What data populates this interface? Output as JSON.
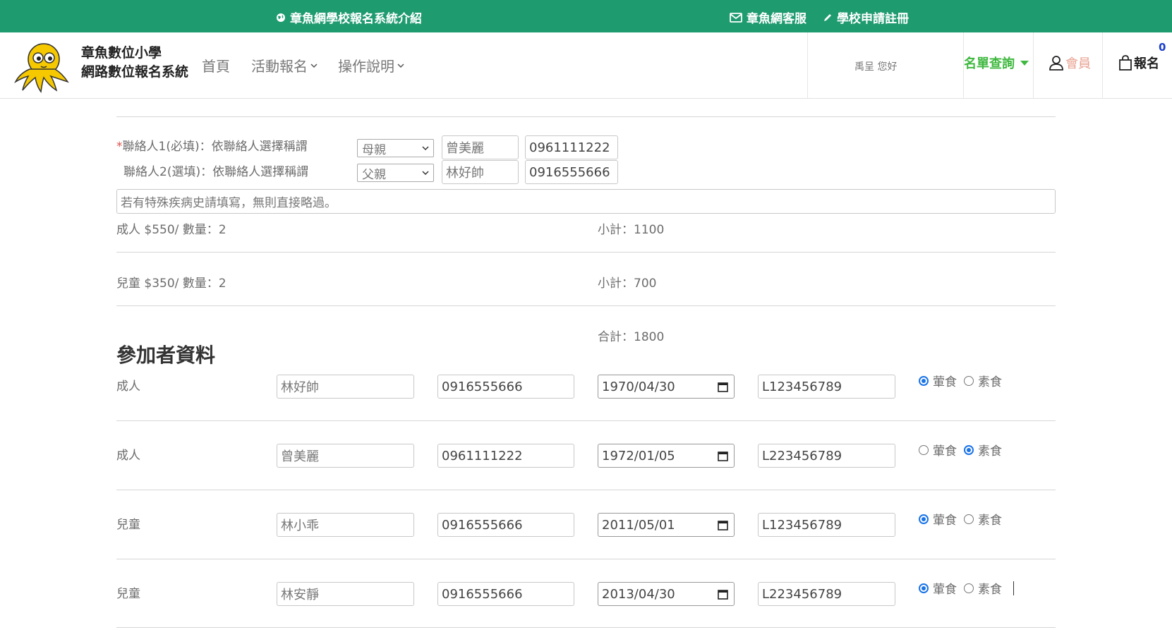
{
  "topbar": {
    "intro": "章魚網學校報名系統介紹",
    "service": "章魚網客服",
    "register": "學校申請註冊"
  },
  "header": {
    "brand_line1": "章魚數位小學",
    "brand_line2": "網路數位報名系統",
    "nav_home": "首頁",
    "nav_activity": "活動報名",
    "nav_help": "操作說明",
    "greeting": "禹呈 您好",
    "namelist": "名單查詢",
    "member": "會員",
    "cart": "報名",
    "cart_count": "0"
  },
  "contacts": {
    "c1_label_req": "*",
    "c1_label": "聯絡人1(必填)：依聯絡人選擇稱謂",
    "c1_relation": "母親",
    "c1_name": "曾美麗",
    "c1_phone": "0961111222",
    "c2_label": "聯絡人2(選填)：依聯絡人選擇稱謂",
    "c2_relation": "父親",
    "c2_name": "林好帥",
    "c2_phone": "0916555666",
    "note_placeholder": "若有特殊疾病史請填寫，無則直接略過。"
  },
  "pricing": {
    "adult": "成人 $550/ 數量：2",
    "adult_subtotal": "小計：1100",
    "child": "兒童 $350/ 數量：2",
    "child_subtotal": "小計：700",
    "total": "合計：1800"
  },
  "participants_title": "參加者資料",
  "participants": [
    {
      "type": "成人",
      "name": "林好帥",
      "phone": "0916555666",
      "birth": "1970/04/30",
      "id": "L123456789",
      "meat": "葷食",
      "veg": "素食",
      "diet": "meat"
    },
    {
      "type": "成人",
      "name": "曾美麗",
      "phone": "0961111222",
      "birth": "1972/01/05",
      "id": "L223456789",
      "meat": "葷食",
      "veg": "素食",
      "diet": "veg"
    },
    {
      "type": "兒童",
      "name": "林小乖",
      "phone": "0916555666",
      "birth": "2011/05/01",
      "id": "L123456789",
      "meat": "葷食",
      "veg": "素食",
      "diet": "meat"
    },
    {
      "type": "兒童",
      "name": "林安靜",
      "phone": "0916555666",
      "birth": "2013/04/30",
      "id": "L223456789",
      "meat": "葷食",
      "veg": "素食",
      "diet": "meat"
    }
  ],
  "colors": {
    "topbar": "#1f9b70",
    "namelist": "#3fb83f",
    "member": "#e8a090",
    "radio_accent": "#1a73e8"
  },
  "icons": {
    "intro": "globe-icon",
    "service": "envelope-icon",
    "register": "pencil-icon",
    "member": "user-icon",
    "cart": "shopping-bag-icon",
    "calendar": "calendar-icon"
  }
}
